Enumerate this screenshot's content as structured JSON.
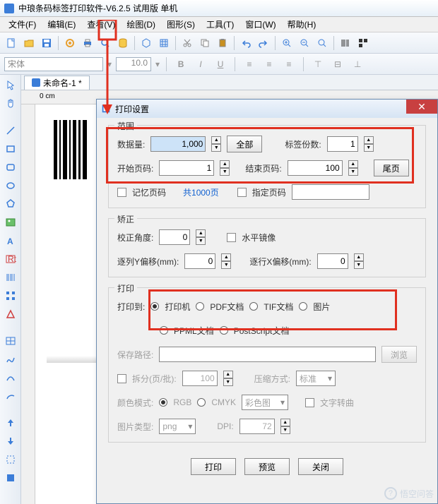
{
  "window": {
    "title": "中琅条码标签打印软件-V6.2.5 试用版 单机"
  },
  "menu": [
    "文件(F)",
    "编辑(E)",
    "查看(V)",
    "绘图(D)",
    "图形(S)",
    "工具(T)",
    "窗口(W)",
    "帮助(H)"
  ],
  "format": {
    "font_placeholder": "宋体",
    "size_placeholder": "10.0"
  },
  "tab": {
    "name": "未命名-1 *"
  },
  "ruler": {
    "origin": "0 cm"
  },
  "dialog": {
    "title": "打印设置",
    "groups": {
      "range": {
        "title": "范围",
        "data_qty_label": "数据量:",
        "data_qty": "1,000",
        "all_btn": "全部",
        "copies_label": "标签份数:",
        "copies": "1",
        "start_label": "开始页码:",
        "start": "1",
        "end_label": "结束页码:",
        "end": "100",
        "last_btn": "尾页",
        "remember_label": "记忆页码",
        "total_pages": "共1000页",
        "specify_label": "指定页码"
      },
      "correct": {
        "title": "矫正",
        "angle_label": "校正角度:",
        "angle": "0",
        "mirror_label": "水平镜像",
        "coly_label": "逐列Y偏移(mm):",
        "coly": "0",
        "rowx_label": "逐行X偏移(mm):",
        "rowx": "0"
      },
      "print": {
        "title": "打印",
        "to_label": "打印到:",
        "opts": [
          "打印机",
          "PDF文档",
          "TIF文档",
          "图片",
          "PPML文档",
          "PostScript文档"
        ],
        "path_label": "保存路径:",
        "browse": "浏览",
        "split_label": "拆分(页/批):",
        "split_val": "100",
        "compress_label": "压缩方式:",
        "compress_val": "标准",
        "color_label": "颜色模式:",
        "color_opts": [
          "RGB",
          "CMYK"
        ],
        "color_sel": "彩色图",
        "text_curve": "文字转曲",
        "imgtype_label": "图片类型:",
        "imgtype_val": "png",
        "dpi_label": "DPI:",
        "dpi_val": "72"
      }
    },
    "buttons": {
      "print": "打印",
      "preview": "预览",
      "close": "关闭"
    }
  },
  "watermark": "悟空问答"
}
